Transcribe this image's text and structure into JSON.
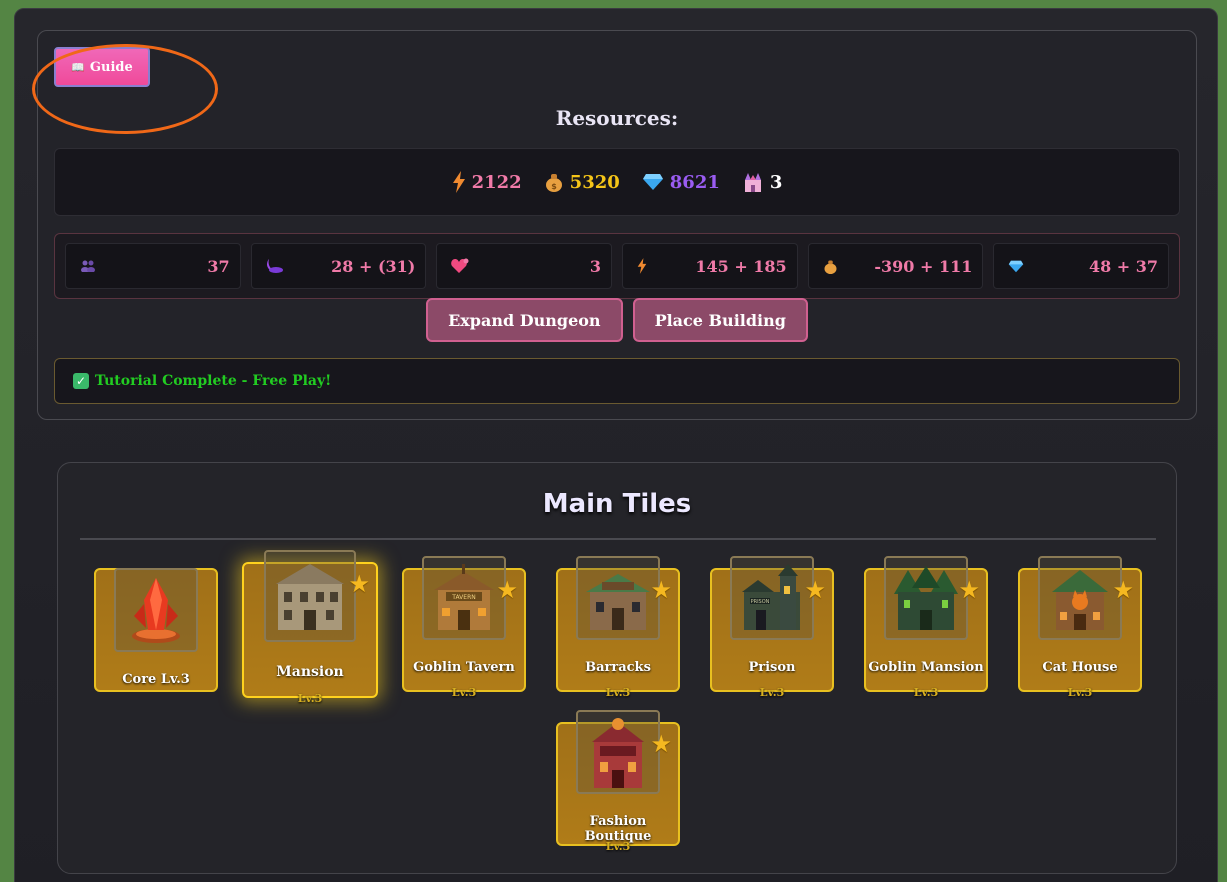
{
  "header": {
    "guide_label": "Guide",
    "resources_title": "Resources:"
  },
  "resources": {
    "energy": "2122",
    "gold": "5320",
    "gems": "8621",
    "castles": "3"
  },
  "stats": [
    {
      "icon": "population-icon",
      "value": "37"
    },
    {
      "icon": "moon-icon",
      "value": "28 + (31)"
    },
    {
      "icon": "heart-icon",
      "value": "3"
    },
    {
      "icon": "energy-icon",
      "value": "145 + 185"
    },
    {
      "icon": "gold-bag-icon",
      "value": "-390 + 111"
    },
    {
      "icon": "gem-icon",
      "value": "48 + 37"
    }
  ],
  "actions": {
    "expand_label": "Expand Dungeon",
    "place_label": "Place Building"
  },
  "tutorial": {
    "status": "Tutorial Complete - Free Play!"
  },
  "tiles_panel": {
    "title": "Main Tiles",
    "tiles": [
      {
        "name": "Core Lv.3",
        "level": "",
        "icon": "crystal-core-icon",
        "star": false
      },
      {
        "name": "Mansion",
        "level": "Lv.3",
        "icon": "mansion-icon",
        "star": true
      },
      {
        "name": "Goblin Tavern",
        "level": "Lv.3",
        "icon": "tavern-icon",
        "star": true
      },
      {
        "name": "Barracks",
        "level": "Lv.3",
        "icon": "barracks-icon",
        "star": true
      },
      {
        "name": "Prison",
        "level": "Lv.3",
        "icon": "prison-icon",
        "star": true
      },
      {
        "name": "Goblin Mansion",
        "level": "Lv.3",
        "icon": "goblin-mansion-icon",
        "star": true
      },
      {
        "name": "Cat House",
        "level": "Lv.3",
        "icon": "cat-house-icon",
        "star": true
      },
      {
        "name": "Fashion Boutique",
        "level": "Lv.3",
        "icon": "boutique-icon",
        "star": true
      }
    ]
  },
  "colors": {
    "accent_pink": "#f07aa8",
    "gold": "#f5c518",
    "gem_purple": "#9a5cf2",
    "tile_border": "#e8c020",
    "success_green": "#22cc22"
  }
}
